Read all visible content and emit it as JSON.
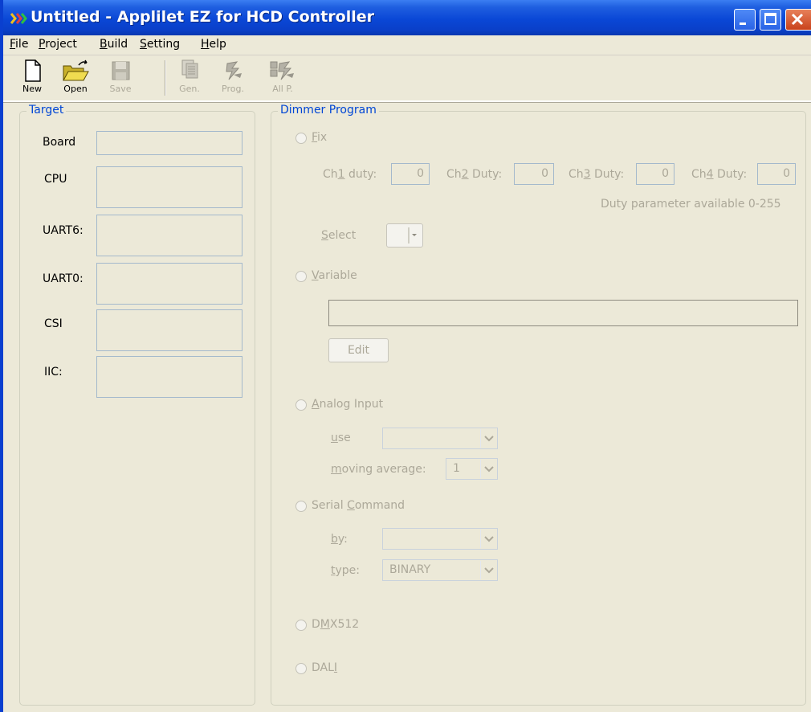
{
  "window": {
    "title": "Untitled - Applilet EZ for HCD Controller"
  },
  "menu": {
    "items": [
      {
        "pre": "",
        "key": "F",
        "post": "ile"
      },
      {
        "pre": "",
        "key": "P",
        "post": "roject"
      },
      {
        "pre": "",
        "key": "B",
        "post": "uild"
      },
      {
        "pre": "",
        "key": "S",
        "post": "etting"
      },
      {
        "pre": "",
        "key": "H",
        "post": "elp"
      }
    ]
  },
  "toolbar": {
    "new_label": "New",
    "open_label": "Open",
    "save_label": "Save",
    "gen_label": "Gen.",
    "prog_label": "Prog.",
    "allp_label": "All P."
  },
  "target": {
    "title": "Target",
    "board_label": "Board",
    "cpu_label": "CPU",
    "uart6_label": "UART6:",
    "uart0_label": "UART0:",
    "csi_label": "CSI",
    "iic_label": "IIC:"
  },
  "dimmer": {
    "title": "Dimmer Program",
    "fix": {
      "key": "F",
      "rest": "ix",
      "ch1": {
        "pre": "Ch",
        "key": "1",
        "post": " duty:",
        "value": "0"
      },
      "ch2": {
        "pre": "Ch",
        "key": "2",
        "post": " Duty:",
        "value": "0"
      },
      "ch3": {
        "pre": "Ch",
        "key": "3",
        "post": " Duty:",
        "value": "0"
      },
      "ch4": {
        "pre": "Ch",
        "key": "4",
        "post": " Duty:",
        "value": "0"
      },
      "hint": "Duty parameter available 0-255",
      "select_key": "S",
      "select_rest": "elect"
    },
    "variable": {
      "key": "V",
      "rest": "ariable",
      "edit_label": "Edit"
    },
    "analog": {
      "key": "A",
      "rest": "nalog Input",
      "use_key": "u",
      "use_rest": "se",
      "moving_key": "m",
      "moving_rest": "oving average:",
      "moving_value": "1"
    },
    "serial": {
      "pre": "Serial ",
      "key": "C",
      "rest": "ommand",
      "by_key": "b",
      "by_rest": "y:",
      "type_key": "t",
      "type_rest": "ype:",
      "type_value": "BINARY"
    },
    "dmx": {
      "pre": "D",
      "key": "M",
      "rest": "X512"
    },
    "dali": {
      "pre": "DAL",
      "key": "I",
      "rest": ""
    }
  }
}
